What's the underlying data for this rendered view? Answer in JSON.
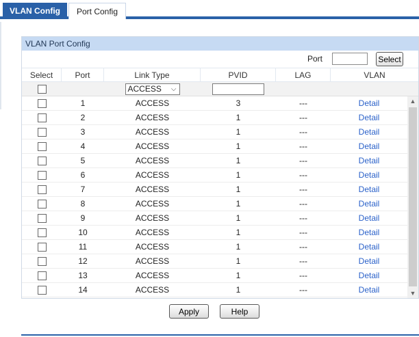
{
  "tabs": [
    {
      "label": "VLAN Config",
      "active": true
    },
    {
      "label": "Port Config",
      "active": false
    }
  ],
  "panel": {
    "title": "VLAN Port Config",
    "port_search_label": "Port",
    "port_search_value": "",
    "select_button": "Select"
  },
  "columns": {
    "select": "Select",
    "port": "Port",
    "link_type": "Link Type",
    "pvid": "PVID",
    "lag": "LAG",
    "vlan": "VLAN"
  },
  "filter": {
    "link_type_value": "ACCESS",
    "pvid_value": ""
  },
  "rows": [
    {
      "port": "1",
      "link_type": "ACCESS",
      "pvid": "3",
      "lag": "---",
      "vlan": "Detail"
    },
    {
      "port": "2",
      "link_type": "ACCESS",
      "pvid": "1",
      "lag": "---",
      "vlan": "Detail"
    },
    {
      "port": "3",
      "link_type": "ACCESS",
      "pvid": "1",
      "lag": "---",
      "vlan": "Detail"
    },
    {
      "port": "4",
      "link_type": "ACCESS",
      "pvid": "1",
      "lag": "---",
      "vlan": "Detail"
    },
    {
      "port": "5",
      "link_type": "ACCESS",
      "pvid": "1",
      "lag": "---",
      "vlan": "Detail"
    },
    {
      "port": "6",
      "link_type": "ACCESS",
      "pvid": "1",
      "lag": "---",
      "vlan": "Detail"
    },
    {
      "port": "7",
      "link_type": "ACCESS",
      "pvid": "1",
      "lag": "---",
      "vlan": "Detail"
    },
    {
      "port": "8",
      "link_type": "ACCESS",
      "pvid": "1",
      "lag": "---",
      "vlan": "Detail"
    },
    {
      "port": "9",
      "link_type": "ACCESS",
      "pvid": "1",
      "lag": "---",
      "vlan": "Detail"
    },
    {
      "port": "10",
      "link_type": "ACCESS",
      "pvid": "1",
      "lag": "---",
      "vlan": "Detail"
    },
    {
      "port": "11",
      "link_type": "ACCESS",
      "pvid": "1",
      "lag": "---",
      "vlan": "Detail"
    },
    {
      "port": "12",
      "link_type": "ACCESS",
      "pvid": "1",
      "lag": "---",
      "vlan": "Detail"
    },
    {
      "port": "13",
      "link_type": "ACCESS",
      "pvid": "1",
      "lag": "---",
      "vlan": "Detail"
    },
    {
      "port": "14",
      "link_type": "ACCESS",
      "pvid": "1",
      "lag": "---",
      "vlan": "Detail"
    }
  ],
  "buttons": {
    "apply": "Apply",
    "help": "Help"
  },
  "icons": {
    "dropdown": "chevron-down-icon",
    "scroll_up": "scroll-up-arrow-icon",
    "scroll_down": "scroll-down-arrow-icon"
  },
  "colors": {
    "brand": "#2a61a8",
    "panel_header": "#c6daf3",
    "link": "#2a61c9"
  }
}
